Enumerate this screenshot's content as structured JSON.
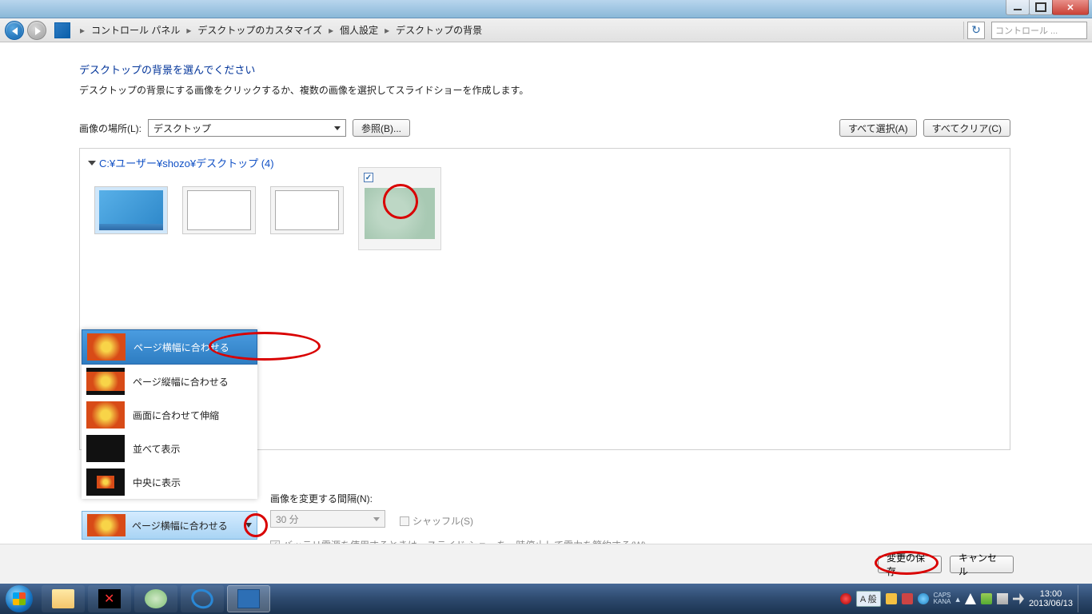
{
  "window": {
    "min": "",
    "max": "",
    "close": "✕"
  },
  "nav": {
    "crumbs": [
      "コントロール パネル",
      "デスクトップのカスタマイズ",
      "個人設定",
      "デスクトップの背景"
    ],
    "search_placeholder": "コントロール ..."
  },
  "page": {
    "heading": "デスクトップの背景を選んでください",
    "subtitle": "デスクトップの背景にする画像をクリックするか、複数の画像を選択してスライドショーを作成します。",
    "location_label": "画像の場所(L):",
    "location_value": "デスクトップ",
    "browse": "参照(B)...",
    "select_all": "すべて選択(A)",
    "clear_all": "すべてクリア(C)",
    "panel_title": "C:¥ユーザー¥shozo¥デスクトップ (4)"
  },
  "fit_options": {
    "fill": "ページ横幅に合わせる",
    "fit": "ページ縦幅に合わせる",
    "stretch": "画面に合わせて伸縮",
    "tile": "並べて表示",
    "center": "中央に表示",
    "current": "ページ横幅に合わせる"
  },
  "interval": {
    "label": "画像を変更する間隔(N):",
    "value": "30 分",
    "shuffle": "シャッフル(S)",
    "battery": "バッテリ電源を使用するときは、スライド ショーを一時停止して電力を節約する(W)"
  },
  "footer": {
    "save": "変更の保存",
    "cancel": "キャンセル"
  },
  "taskbar": {
    "ime": "A 般",
    "caps": "CAPS",
    "kana": "KANA",
    "time": "13:00",
    "date": "2013/06/13"
  }
}
